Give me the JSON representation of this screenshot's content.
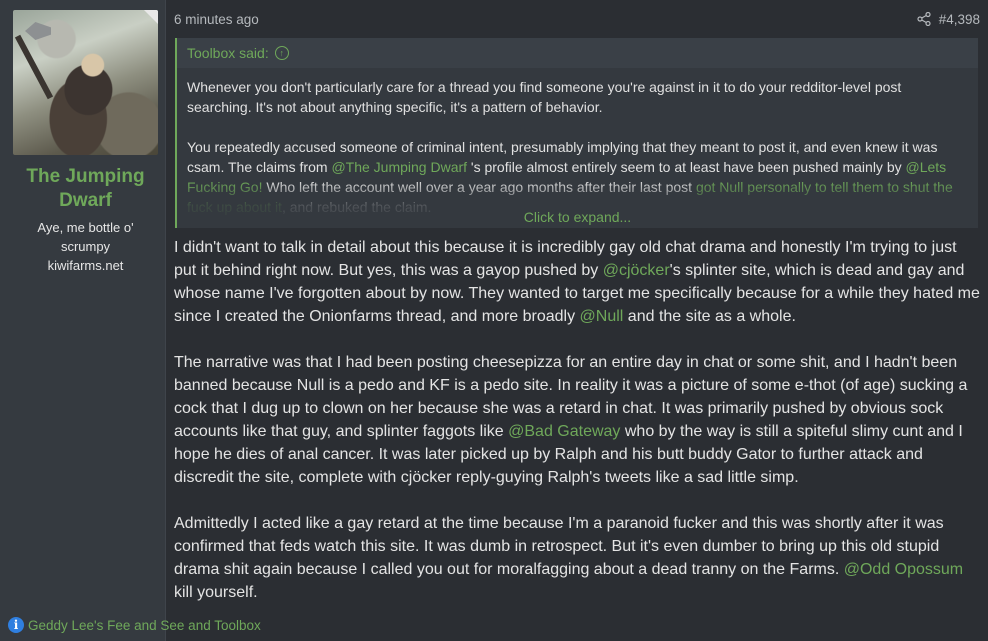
{
  "user": {
    "name": "The Jumping Dwarf",
    "title_line1": "Aye, me bottle o'",
    "title_line2": "scrumpy",
    "title_line3": "kiwifarms.net"
  },
  "post": {
    "time": "6 minutes ago",
    "number": "#4,398",
    "share_icon": "share-icon"
  },
  "quote": {
    "author_label": "Toolbox said:",
    "para1": "Whenever you don't particularly care for a thread you find someone you're against in it to do your redditor-level post searching. It's not about anything specific, it's a pattern of behavior.",
    "para2_a": "You repeatedly accused someone of criminal intent, presumably implying that they meant to post it, and even knew it was csam. The claims from ",
    "para2_mention1": "@The Jumping Dwarf",
    "para2_b": " 's profile almost entirely seem to at least have been pushed mainly by ",
    "para2_mention2": "@Lets Fucking Go!",
    "para2_c": " Who left the account well over a year ago months after their last post ",
    "para2_link": "got Null personally to tell them to shut the fuck up about it",
    "para2_d": ", and rebuked the claim.",
    "expand_label": "Click to expand..."
  },
  "message": {
    "p1_a": "I didn't want to talk in detail about this because it is incredibly gay old chat drama and honestly I'm trying to just put it behind right now. But yes, this was a gayop pushed by ",
    "p1_mention1": "@cjöcker",
    "p1_b": "'s splinter site, which is dead and gay and whose name I've forgotten about by now. They wanted to target me specifically because for a while they hated me since I created the Onionfarms thread, and more broadly ",
    "p1_mention2": "@Null",
    "p1_c": " and the site as a whole.",
    "p2_a": "The narrative was that I had been posting cheesepizza for an entire day in chat or some shit, and I hadn't been banned because Null is a pedo and KF is a pedo site. In reality it was a picture of some e-thot (of age) sucking a cock that I dug up to clown on her because she was a retard in chat. It was primarily pushed by obvious sock accounts like that guy, and splinter faggots like ",
    "p2_mention": "@Bad Gateway",
    "p2_b": " who by the way is still a spiteful slimy cunt and I hope he dies of anal cancer. It was later picked up by Ralph and his butt buddy Gator to further attack and discredit the site, complete with cjöcker reply-guying Ralph's tweets like a sad little simp.",
    "p3_a": "Admittedly I acted like a gay retard at the time because I'm a paranoid fucker and this was shortly after it was confirmed that feds watch this site. It was dumb in retrospect. But it's even dumber to bring up this old stupid drama shit again because I called you out for moralfagging about a dead tranny on the Farms. ",
    "p3_mention": "@Odd Opossum",
    "p3_b": " kill yourself."
  },
  "reactions": {
    "text": "Geddy Lee's Fee and See and Toolbox",
    "icon": "info-icon"
  },
  "colors": {
    "accent": "#6fa85a",
    "background": "#2b2e33",
    "user_cell": "#353a40",
    "quote_bg": "#34393f"
  }
}
